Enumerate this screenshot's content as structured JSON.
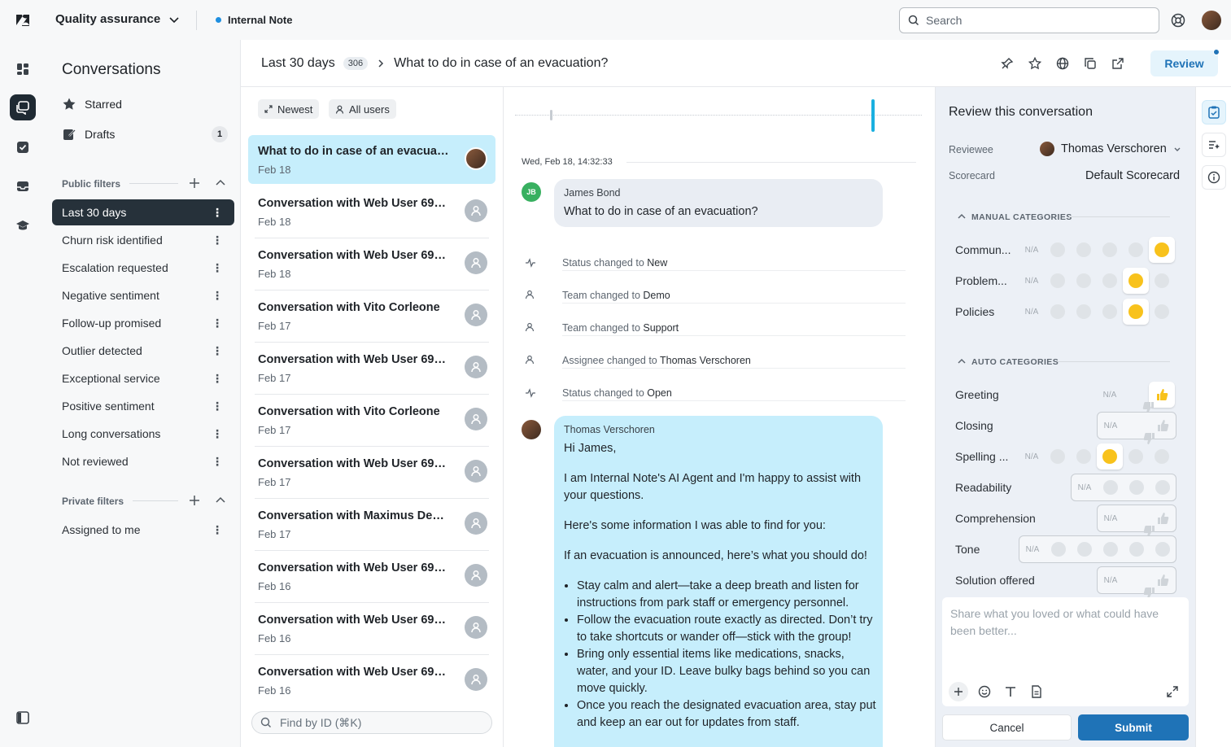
{
  "topbar": {
    "workspace": "Quality assurance",
    "tab_label": "Internal Note",
    "search_placeholder": "Search"
  },
  "filters": {
    "title": "Conversations",
    "starred_label": "Starred",
    "drafts_label": "Drafts",
    "drafts_count": "1",
    "public_header": "Public filters",
    "public_items": [
      {
        "label": "Last 30 days",
        "active": true
      },
      {
        "label": "Churn risk identified"
      },
      {
        "label": "Escalation requested"
      },
      {
        "label": "Negative sentiment"
      },
      {
        "label": "Follow-up promised"
      },
      {
        "label": "Outlier detected"
      },
      {
        "label": "Exceptional service"
      },
      {
        "label": "Positive sentiment"
      },
      {
        "label": "Long conversations"
      },
      {
        "label": "Not reviewed"
      }
    ],
    "private_header": "Private filters",
    "private_items": [
      {
        "label": "Assigned to me"
      }
    ]
  },
  "header": {
    "filter_name": "Last 30 days",
    "count": "306",
    "title": "What to do in case of an evacuation?",
    "review_button": "Review"
  },
  "list": {
    "sort_label": "Newest",
    "users_label": "All users",
    "find_placeholder": "Find by ID (⌘K)",
    "items": [
      {
        "title": "What to do in case of an evacuati...",
        "date": "Feb 18"
      },
      {
        "title": "Conversation with Web User 693...",
        "date": "Feb 18"
      },
      {
        "title": "Conversation with Web User 698...",
        "date": "Feb 18"
      },
      {
        "title": "Conversation with Vito Corleone",
        "date": "Feb 17"
      },
      {
        "title": "Conversation with Web User 699...",
        "date": "Feb 17"
      },
      {
        "title": "Conversation with Vito Corleone",
        "date": "Feb 17"
      },
      {
        "title": "Conversation with Web User 699...",
        "date": "Feb 17"
      },
      {
        "title": "Conversation with Maximus Deci...",
        "date": "Feb 17"
      },
      {
        "title": "Conversation with Web User 698...",
        "date": "Feb 16"
      },
      {
        "title": "Conversation with Web User 698...",
        "date": "Feb 16"
      },
      {
        "title": "Conversation with Web User 699...",
        "date": "Feb 16"
      }
    ]
  },
  "thread": {
    "timestamp": "Wed, Feb 18, 14:32:33",
    "customer_initials": "JB",
    "customer_name": "James Bond",
    "customer_message": "What to do in case of an evacuation?",
    "events": [
      {
        "icon": "activity-icon",
        "prefix": "Status changed to ",
        "value": "New"
      },
      {
        "icon": "person-icon",
        "prefix": "Team changed to ",
        "value": "Demo"
      },
      {
        "icon": "person-icon",
        "prefix": "Team changed to ",
        "value": "Support"
      },
      {
        "icon": "person-icon",
        "prefix": "Assignee changed to ",
        "value": "Thomas Verschoren"
      },
      {
        "icon": "activity-icon",
        "prefix": "Status changed to ",
        "value": "Open"
      }
    ],
    "agent_name": "Thomas Verschoren",
    "agent_greeting": "Hi James,",
    "agent_p1": "I am Internal Note's AI Agent and I'm happy to assist with your questions.",
    "agent_p2": "Here's some information I was able to find for you:",
    "agent_p3": "If an evacuation is announced, here’s what you should do!",
    "bullets": [
      "Stay calm and alert—take a deep breath and listen for instructions from park staff or emergency personnel.",
      "Follow the evacuation route exactly as directed. Don’t try to take shortcuts or wander off—stick with the group!",
      "Bring only essential items like medications, snacks, water, and your ID. Leave bulky bags behind so you can move quickly.",
      "Once you reach the designated evacuation area, stay put and keep an ear out for updates from staff."
    ]
  },
  "review": {
    "title": "Review this conversation",
    "reviewee_label": "Reviewee",
    "reviewee_value": "Thomas Verschoren",
    "scorecard_label": "Scorecard",
    "scorecard_value": "Default Scorecard",
    "manual_header": "MANUAL CATEGORIES",
    "auto_header": "AUTO CATEGORIES",
    "na": "N/A",
    "manual": [
      {
        "name": "Commun...",
        "rating": 5
      },
      {
        "name": "Problem...",
        "rating": 4
      },
      {
        "name": "Policies",
        "rating": 4
      }
    ],
    "auto": [
      {
        "name": "Greeting",
        "type": "thumbs",
        "rating": "up"
      },
      {
        "name": "Closing",
        "type": "thumbs",
        "rating": "none"
      },
      {
        "name": "Spelling ...",
        "type": "five",
        "rating": 3
      },
      {
        "name": "Readability",
        "type": "three",
        "rating": "none"
      },
      {
        "name": "Comprehension",
        "type": "thumbs",
        "rating": "none"
      },
      {
        "name": "Tone",
        "type": "five",
        "rating": "none"
      },
      {
        "name": "Solution offered",
        "type": "thumbs",
        "rating": "none"
      }
    ],
    "comment_placeholder": "Share what you loved or what could have been better...",
    "cancel_label": "Cancel",
    "submit_label": "Submit"
  },
  "colors": {
    "accent": "#1f73b7",
    "selected_conversation": "#c6eefc",
    "agent_bubble": "#c6eefc",
    "review_panel": "#ecf0f6",
    "emoji_yellow": "#f8c21c"
  }
}
